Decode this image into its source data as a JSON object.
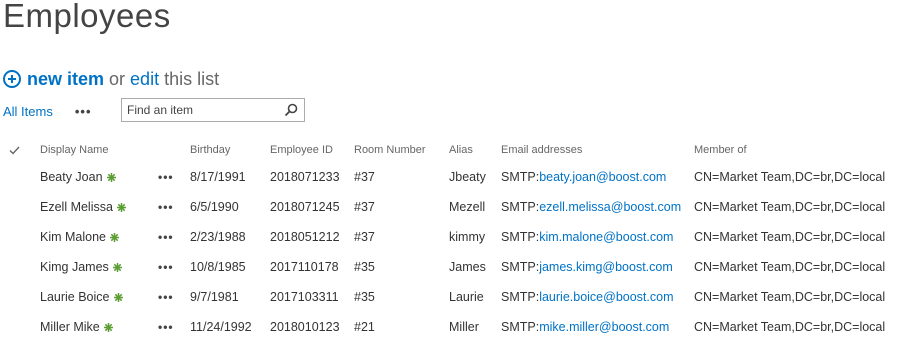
{
  "page": {
    "title": "Employees",
    "new_item_label": "new item",
    "or_text": "or",
    "edit_label": "edit",
    "this_list_text": "this list"
  },
  "view": {
    "current_view": "All Items",
    "more_label": "•••",
    "search_placeholder": "Find an item"
  },
  "table": {
    "columns": {
      "display_name": "Display Name",
      "birthday": "Birthday",
      "employee_id": "Employee ID",
      "room_number": "Room Number",
      "alias": "Alias",
      "email": "Email addresses",
      "member_of": "Member of"
    },
    "row_menu_label": "•••",
    "email_prefix": "SMTP:",
    "rows": [
      {
        "name": "Beaty Joan",
        "birthday": "8/17/1991",
        "employee_id": "2018071233",
        "room": "#37",
        "alias": "Jbeaty",
        "email": "beaty.joan@boost.com",
        "member_of": "CN=Market Team,DC=br,DC=local"
      },
      {
        "name": "Ezell Melissa",
        "birthday": "6/5/1990",
        "employee_id": "2018071245",
        "room": "#37",
        "alias": "Mezell",
        "email": "ezell.melissa@boost.com",
        "member_of": "CN=Market Team,DC=br,DC=local"
      },
      {
        "name": "Kim Malone",
        "birthday": "2/23/1988",
        "employee_id": "2018051212",
        "room": "#37",
        "alias": "kimmy",
        "email": "kim.malone@boost.com",
        "member_of": "CN=Market Team,DC=br,DC=local"
      },
      {
        "name": "Kimg James",
        "birthday": "10/8/1985",
        "employee_id": "2017110178",
        "room": "#35",
        "alias": "James",
        "email": "james.kimg@boost.com",
        "member_of": "CN=Market Team,DC=br,DC=local"
      },
      {
        "name": "Laurie Boice",
        "birthday": "9/7/1981",
        "employee_id": "2017103311",
        "room": "#35",
        "alias": "Laurie",
        "email": "laurie.boice@boost.com",
        "member_of": "CN=Market Team,DC=br,DC=local"
      },
      {
        "name": "Miller Mike",
        "birthday": "11/24/1992",
        "employee_id": "2018010123",
        "room": "#21",
        "alias": "Miller",
        "email": "mike.miller@boost.com",
        "member_of": "CN=Market Team,DC=br,DC=local"
      }
    ]
  },
  "colors": {
    "accent": "#0072c6",
    "new_badge": "#5b9d32"
  }
}
